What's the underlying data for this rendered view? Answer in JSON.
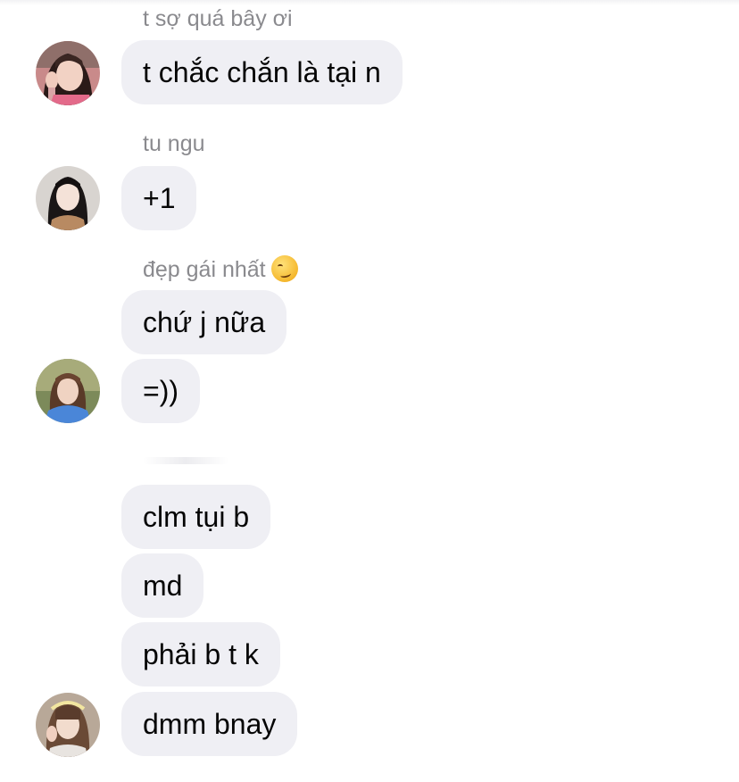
{
  "groups": [
    {
      "sender": "t sợ quá bây ơi",
      "avatar_icon": "profile-photo-girl-peace-sign",
      "messages": [
        "t chắc chắn là tại n"
      ]
    },
    {
      "sender": "tu ngu",
      "avatar_icon": "profile-photo-girl-long-black-hair",
      "messages": [
        "+1"
      ]
    },
    {
      "sender": "đẹp gái nhất",
      "sender_emoji": "smirking-face-emoji",
      "avatar_icon": "profile-photo-girl-blue-shirt",
      "messages": [
        "chứ j nữa",
        "=))"
      ]
    },
    {
      "sender": "",
      "avatar_icon": "profile-photo-girl-bangs",
      "messages": [
        "clm tụi b",
        "md",
        "phải b t k",
        "dmm bnay"
      ]
    }
  ],
  "colors": {
    "bubble": "#efeff4",
    "text": "#050505",
    "sender": "#8a8a8e",
    "background": "#ffffff"
  }
}
